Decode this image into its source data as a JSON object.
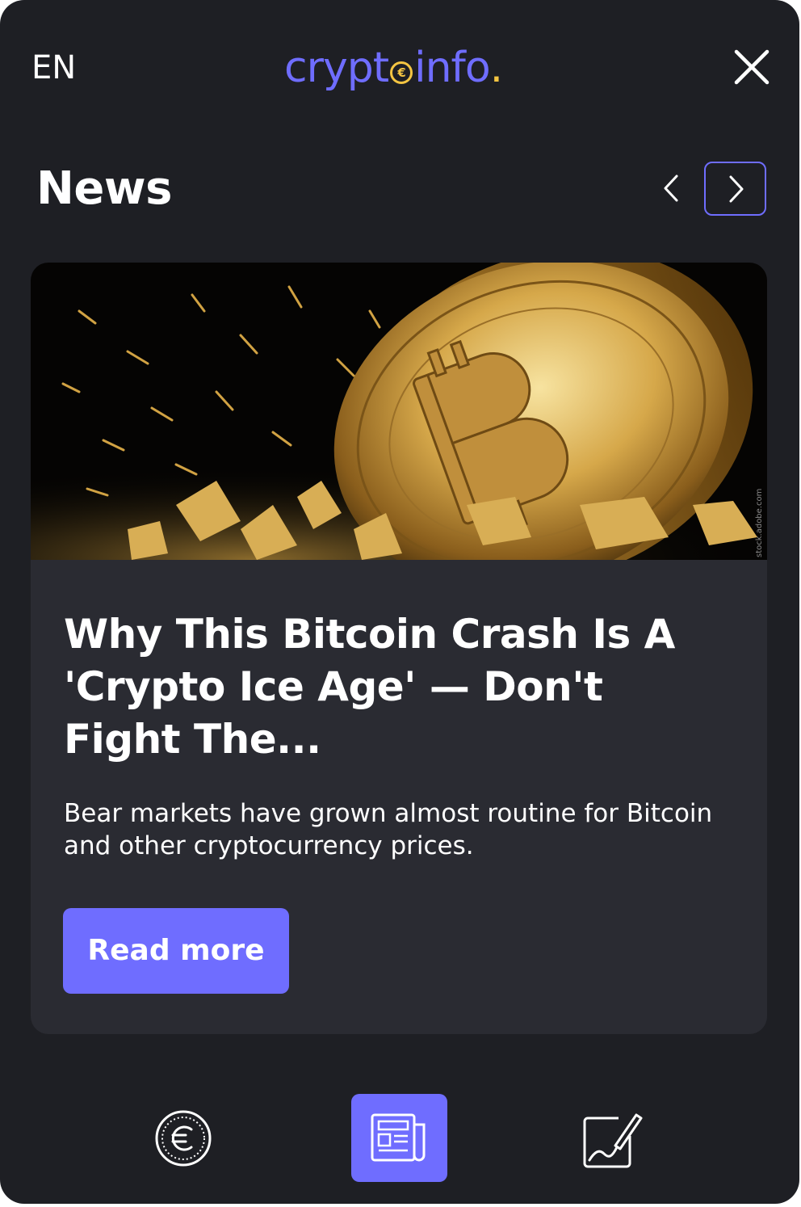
{
  "header": {
    "language": "EN",
    "logo": {
      "part1": "crypt",
      "coin_symbol": "€",
      "part2": "info",
      "dot": "."
    },
    "close_icon": "close-icon"
  },
  "news": {
    "title": "News",
    "prev_icon": "chevron-left-icon",
    "next_icon": "chevron-right-icon"
  },
  "article": {
    "image_icon": "bitcoin-coin-photo",
    "image_credit": "stock.adobe.com",
    "headline": "Why This Bitcoin Crash Is A 'Crypto Ice Age' — Don't Fight The...",
    "summary": "Bear markets have grown almost routine for Bitcoin and other cryptocurrency prices.",
    "read_more_label": "Read more"
  },
  "bottom_nav": {
    "items": [
      {
        "icon": "euro-coin-icon",
        "active": false
      },
      {
        "icon": "newspaper-icon",
        "active": true
      },
      {
        "icon": "signature-icon",
        "active": false
      }
    ]
  },
  "colors": {
    "background": "#1e1f24",
    "card": "#2a2b32",
    "accent": "#6f6dff",
    "logo_coin": "#f4c542",
    "text": "#ffffff"
  }
}
